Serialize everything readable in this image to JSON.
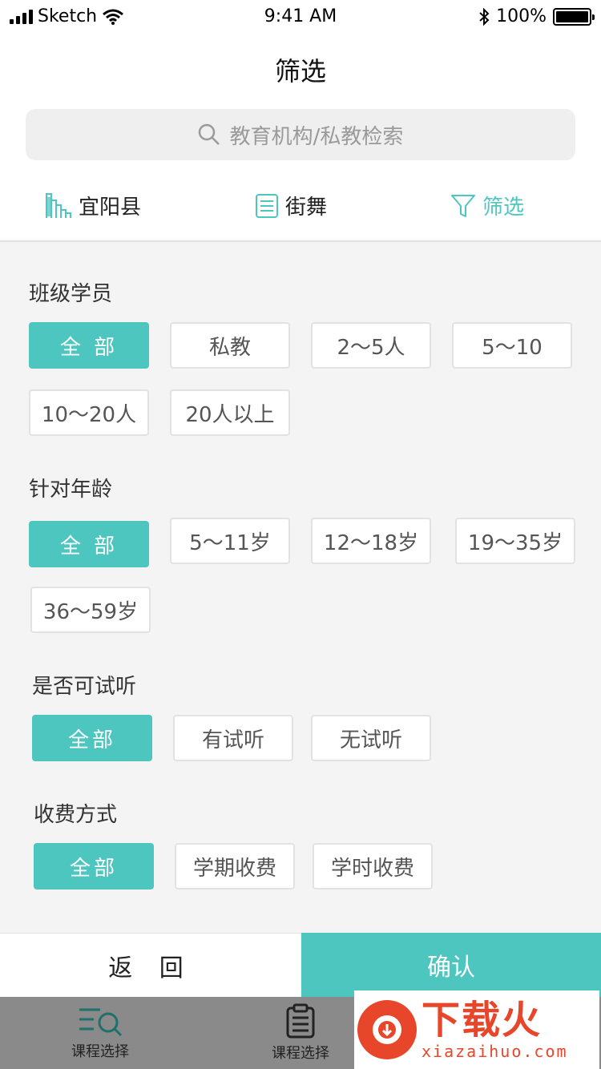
{
  "status_bar": {
    "carrier": "Sketch",
    "time": "9:41 AM",
    "battery": "100%"
  },
  "nav": {
    "title": "筛选"
  },
  "search": {
    "placeholder": "教育机构/私教检索"
  },
  "filter_bar": {
    "location": "宜阳县",
    "category": "街舞",
    "filter": "筛选"
  },
  "sections": {
    "class_size": {
      "title": "班级学员",
      "options": [
        "全 部",
        "私教",
        "2～5人",
        "5～10",
        "10～20人",
        "20人以上"
      ]
    },
    "age": {
      "title": "针对年龄",
      "options": [
        "全 部",
        "5～11岁",
        "12～18岁",
        "19～35岁",
        "36～59岁"
      ]
    },
    "trial": {
      "title": "是否可试听",
      "options": [
        "全部",
        "有试听",
        "无试听"
      ]
    },
    "fee": {
      "title": "收费方式",
      "options": [
        "全部",
        "学期收费",
        "学时收费"
      ]
    }
  },
  "actions": {
    "back": "返 回",
    "confirm": "确认"
  },
  "tabbar": {
    "tab1": "课程选择",
    "tab2": "课程选择"
  },
  "watermark": {
    "brand": "下载火",
    "url": "xiazaihuo.com"
  },
  "colors": {
    "accent": "#4ec6c0",
    "watermark": "#e8462a"
  }
}
